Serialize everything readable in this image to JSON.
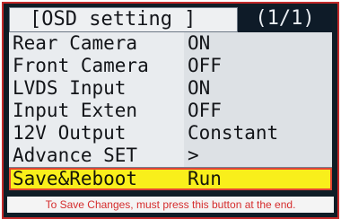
{
  "header": {
    "title": "[OSD setting ]",
    "page_indicator": "(1/1)"
  },
  "menu": {
    "items": [
      {
        "label": "Rear Camera",
        "value": "ON"
      },
      {
        "label": "Front Camera",
        "value": "OFF"
      },
      {
        "label": "LVDS Input",
        "value": "ON"
      },
      {
        "label": "Input Exten",
        "value": "OFF"
      },
      {
        "label": "12V Output",
        "value": "Constant"
      },
      {
        "label": "Advance SET",
        "value": ">"
      },
      {
        "label": "Save&Reboot",
        "value": "Run"
      }
    ],
    "selected_index": 6
  },
  "footer": {
    "hint": "To Save Changes, must press this button at the end."
  },
  "colors": {
    "highlight": "#f9ef1b",
    "highlight_border": "#e14434",
    "hint_text": "#d52d2d",
    "header_bg_dark": "#0e1b28"
  }
}
